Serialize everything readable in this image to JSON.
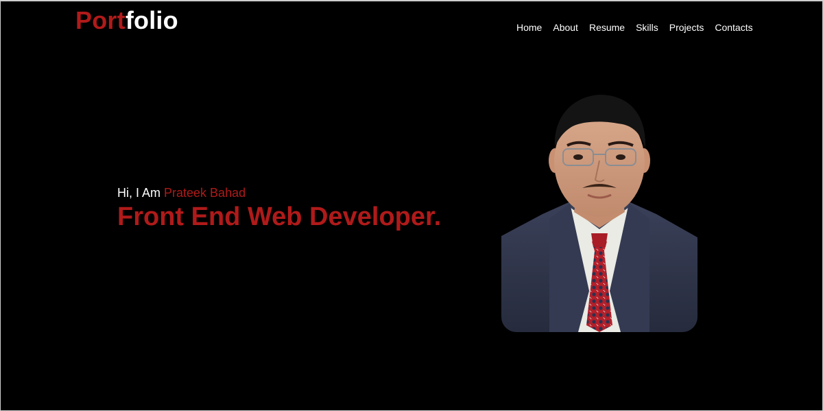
{
  "logo": {
    "accent": "Port",
    "rest": "folio"
  },
  "nav": {
    "items": [
      {
        "label": "Home"
      },
      {
        "label": "About"
      },
      {
        "label": "Resume"
      },
      {
        "label": "Skills"
      },
      {
        "label": "Projects"
      },
      {
        "label": "Contacts"
      }
    ]
  },
  "hero": {
    "greeting": "Hi, I Am ",
    "name": "Prateek Bahad",
    "headline": "Front End Web Developer."
  },
  "colors": {
    "background": "#000000",
    "accent": "#b01a1a",
    "text": "#ffffff"
  }
}
